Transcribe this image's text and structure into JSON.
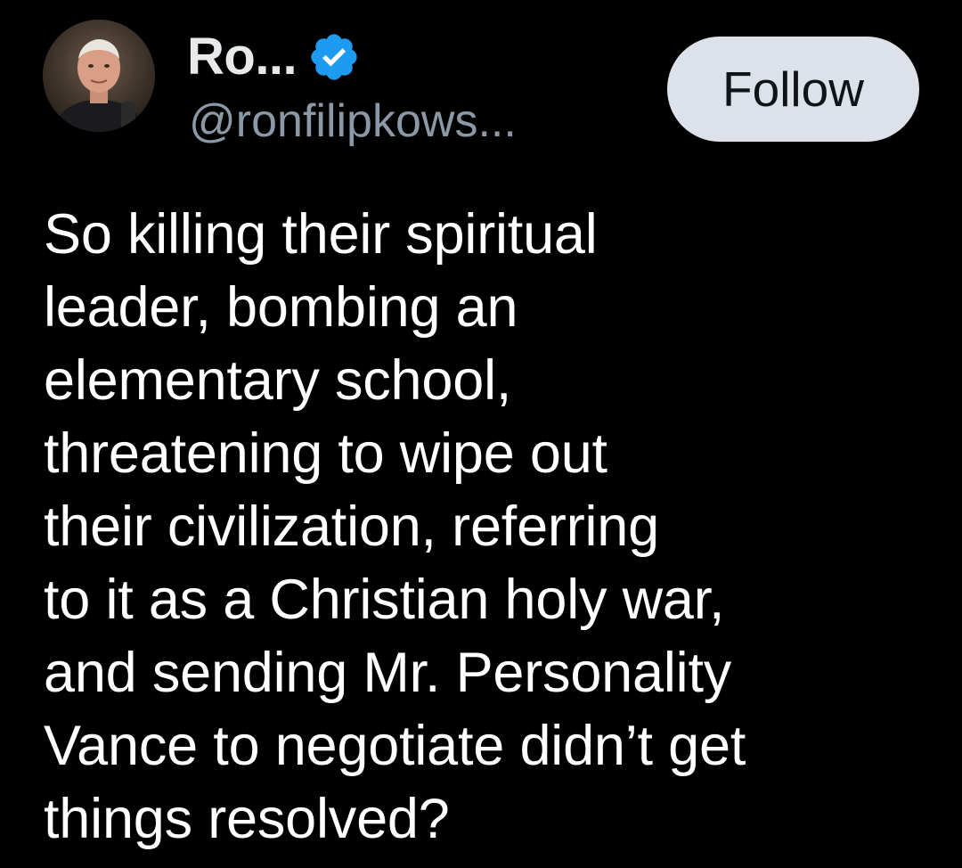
{
  "author": {
    "display_name": "Ro...",
    "handle": "@ronfilipkows...",
    "verified": true,
    "verified_color": "#1d9bf0",
    "avatar_icon": "profile-photo"
  },
  "actions": {
    "follow_label": "Follow"
  },
  "post": {
    "text": "So killing their spiritual\nleader, bombing an\nelementary school,\nthreatening to wipe out\ntheir civilization, referring\nto it as a Christian holy war,\nand sending Mr. Personality\nVance to negotiate didn’t get\nthings resolved?"
  },
  "colors": {
    "background": "#000000",
    "text": "#ffffff",
    "handle": "#8b98a5",
    "follow_bg": "#dde1e9",
    "follow_text": "#0f1419"
  }
}
